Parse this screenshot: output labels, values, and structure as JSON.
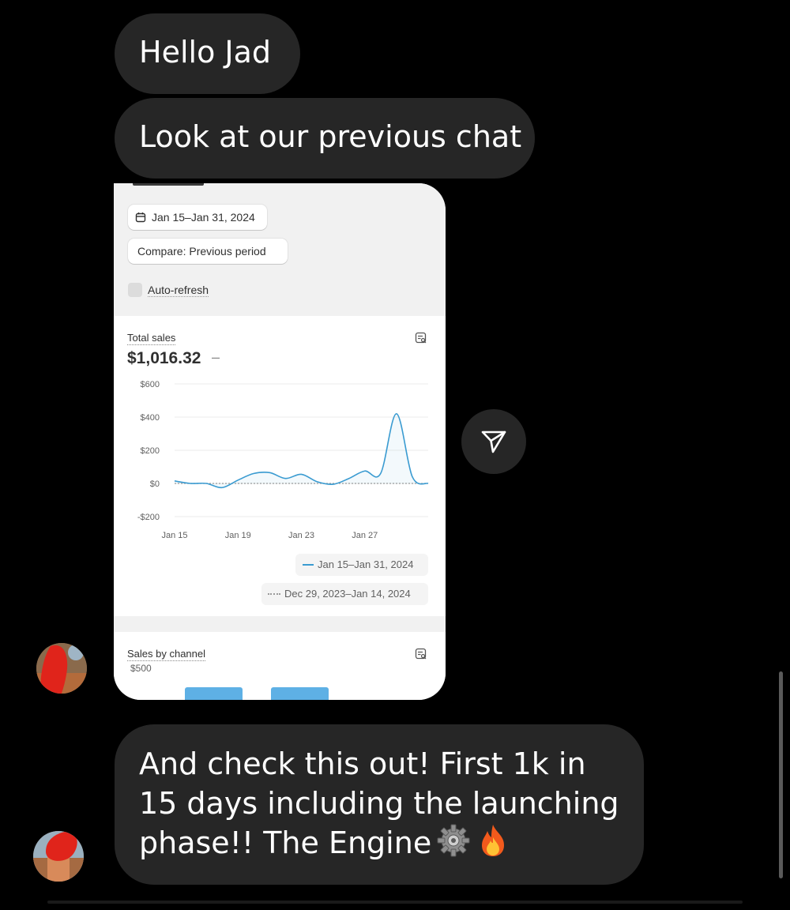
{
  "messages": [
    {
      "text": "Hello Jad"
    },
    {
      "text": "Look at our previous chat"
    },
    {
      "text": "And check this out! First 1k in 15 days including the launching phase!! The Engine"
    }
  ],
  "emoji": [
    "gear-icon",
    "fire-icon"
  ],
  "screenshot": {
    "date_range": "Jan 15–Jan 31, 2024",
    "compare": "Compare: Previous period",
    "auto_refresh": "Auto-refresh",
    "total_sales": {
      "title": "Total sales",
      "value": "$1,016.32",
      "delta": "–"
    },
    "legend": {
      "current": "Jan 15–Jan 31, 2024",
      "previous": "Dec 29, 2023–Jan 14, 2024"
    },
    "sales_by_channel": {
      "title": "Sales by channel",
      "axis_top": "$500"
    }
  },
  "chart_data": {
    "type": "line",
    "title": "Total sales",
    "y_ticks": [
      "$600",
      "$400",
      "$200",
      "$0",
      "-$200"
    ],
    "x_ticks": [
      "Jan 15",
      "Jan 19",
      "Jan 23",
      "Jan 27"
    ],
    "ylim": [
      -200,
      600
    ],
    "series": [
      {
        "name": "Jan 15–Jan 31, 2024",
        "color": "#3a9bd1",
        "x": [
          0,
          1,
          2,
          3,
          4,
          5,
          6,
          7,
          8,
          9,
          10,
          11,
          12,
          13,
          14,
          15,
          16
        ],
        "y": [
          15,
          0,
          0,
          -25,
          20,
          60,
          65,
          30,
          55,
          10,
          -5,
          30,
          75,
          60,
          420,
          40,
          0
        ]
      },
      {
        "name": "Dec 29, 2023–Jan 14, 2024",
        "color": "#9a9a9a",
        "x": [
          0,
          1,
          2,
          3,
          4,
          5,
          6,
          7,
          8,
          9,
          10,
          11,
          12,
          13,
          14,
          15,
          16
        ],
        "y": [
          0,
          0,
          0,
          0,
          0,
          0,
          0,
          0,
          0,
          0,
          0,
          0,
          0,
          0,
          0,
          0,
          0
        ]
      }
    ],
    "grid": true,
    "legend_position": "bottom-right"
  }
}
